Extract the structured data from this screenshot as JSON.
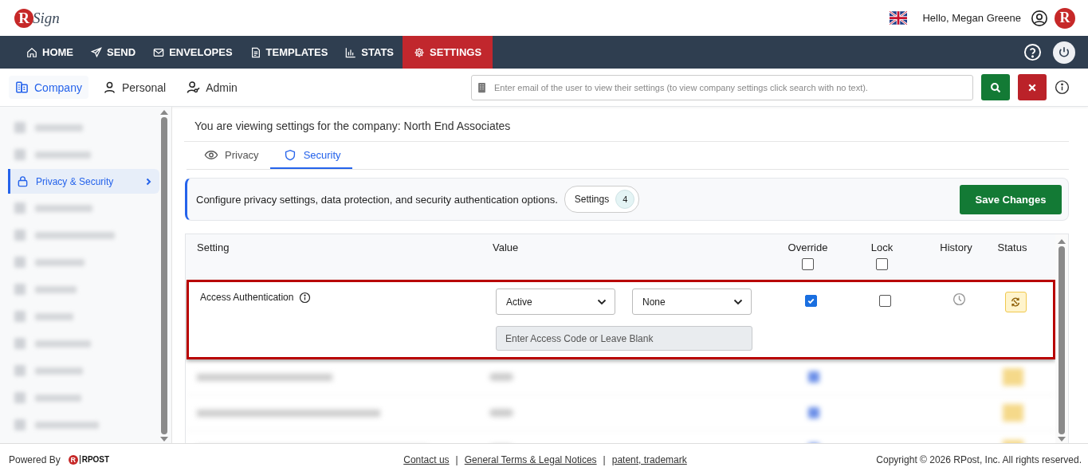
{
  "header": {
    "logo_mark": "R",
    "logo_word": "Sign",
    "greeting": "Hello, Megan Greene",
    "avatar": "R"
  },
  "nav": [
    {
      "label": "HOME",
      "selected": false
    },
    {
      "label": "SEND",
      "selected": false
    },
    {
      "label": "ENVELOPES",
      "selected": false
    },
    {
      "label": "TEMPLATES",
      "selected": false
    },
    {
      "label": "STATS",
      "selected": false
    },
    {
      "label": "SETTINGS",
      "selected": true
    }
  ],
  "scope_tabs": [
    {
      "label": "Company",
      "selected": true
    },
    {
      "label": "Personal",
      "selected": false
    },
    {
      "label": "Admin",
      "selected": false
    }
  ],
  "search": {
    "placeholder": "Enter email of the user to view their settings (to view company settings click search with no text)."
  },
  "sidebar": {
    "items": [
      {
        "kind": "blurred"
      },
      {
        "kind": "blurred"
      },
      {
        "kind": "item",
        "label": "Privacy & Security",
        "selected": true
      },
      {
        "kind": "blurred"
      },
      {
        "kind": "blurred"
      },
      {
        "kind": "blurred"
      },
      {
        "kind": "blurred"
      },
      {
        "kind": "blurred"
      },
      {
        "kind": "blurred"
      },
      {
        "kind": "blurred"
      },
      {
        "kind": "blurred"
      },
      {
        "kind": "blurred"
      }
    ]
  },
  "heading": "You are viewing settings for the company: North End Associates",
  "section_tabs": [
    {
      "label": "Privacy",
      "selected": false
    },
    {
      "label": "Security",
      "selected": true
    }
  ],
  "info": {
    "text": "Configure privacy settings, data protection, and security authentication options.",
    "badge_label": "Settings",
    "badge_count": "4",
    "save": "Save Changes"
  },
  "table": {
    "columns": [
      "Setting",
      "Value",
      "Override",
      "Lock",
      "History",
      "Status"
    ],
    "override_all_checked": false,
    "lock_all_checked": false,
    "rows": [
      {
        "kind": "setting",
        "name": "Access Authentication",
        "highlighted": true,
        "selects": [
          "Active",
          "None"
        ],
        "code_placeholder": "Enter Access Code or Leave Blank",
        "override": true,
        "lock": false
      },
      {
        "kind": "blurred"
      },
      {
        "kind": "blurred"
      },
      {
        "kind": "blurred"
      }
    ]
  },
  "footer": {
    "powered": "Powered By",
    "logo_mark": "R",
    "logo_word": "RPOST",
    "links": [
      "Contact us",
      "General Terms & Legal Notices",
      "patent, trademark"
    ],
    "separators": [
      "|",
      "|"
    ],
    "copyright": "Copyright © 2026 RPost, Inc. All rights reserved."
  }
}
